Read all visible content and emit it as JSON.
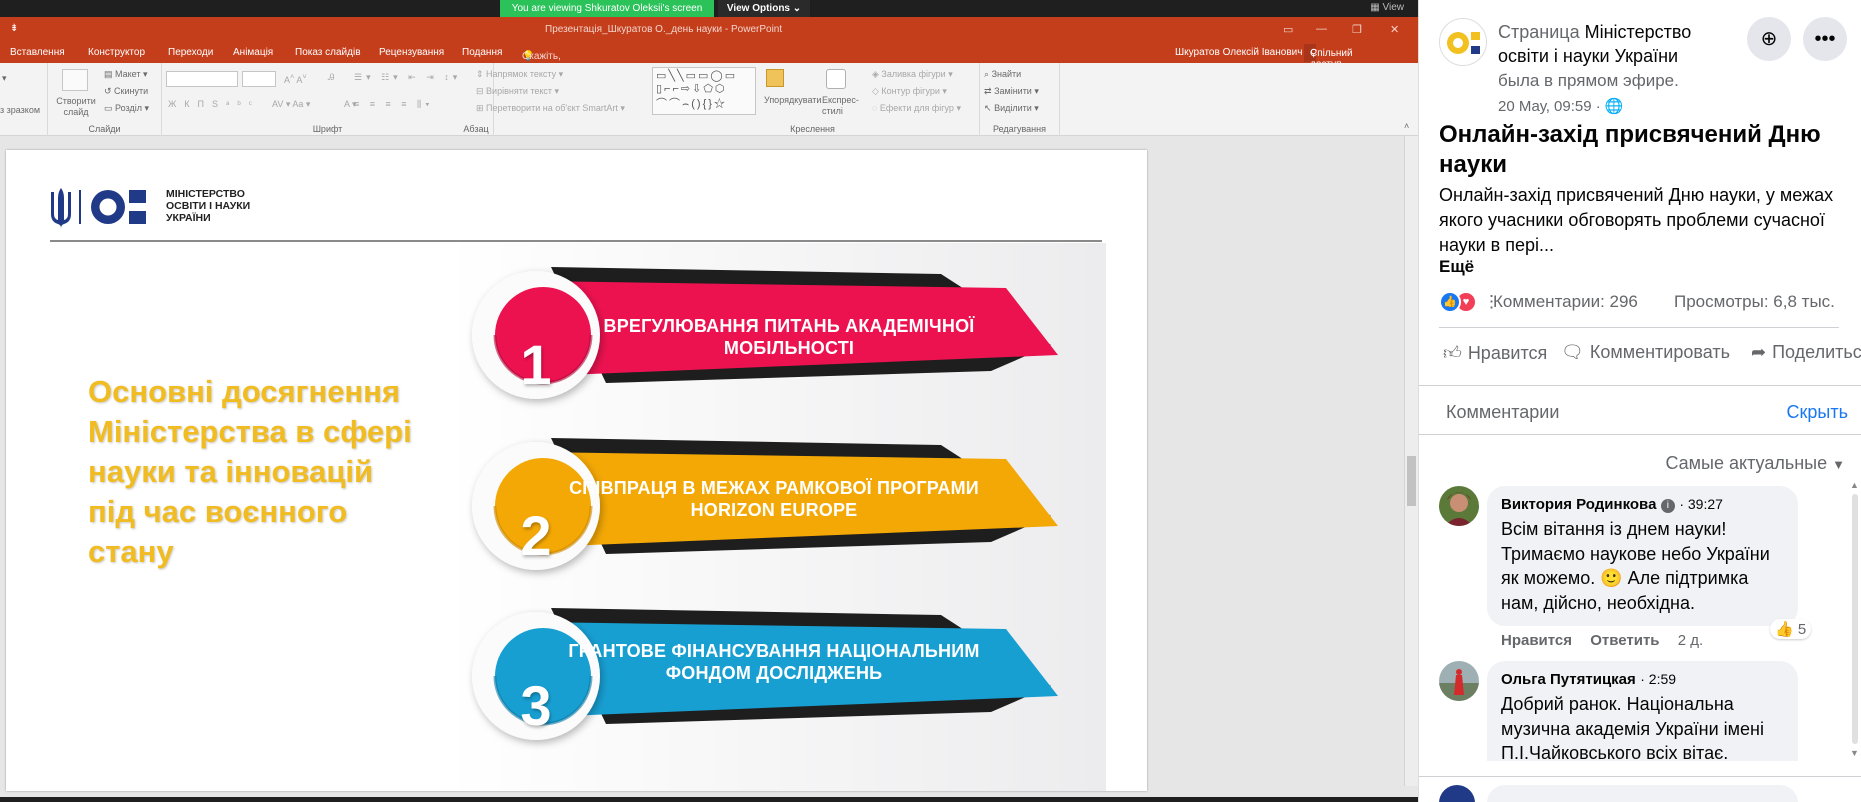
{
  "zoom": {
    "share_banner": "You are viewing Shkuratov Oleksii's screen",
    "view_options": "View Options",
    "view_label": "View"
  },
  "powerpoint": {
    "window_title": "Презентація_Шкуратов О._день науки - PowerPoint",
    "tabs": [
      "Вставлення",
      "Конструктор",
      "Переходи",
      "Анімація",
      "Показ слайдів",
      "Рецензування",
      "Подання"
    ],
    "tell_me": "Скажіть, що потрібно зробити...",
    "user": "Шкуратов Олексій Іванович",
    "share": "Спільний доступ",
    "ribbon": {
      "groups": [
        "Слайди",
        "Шрифт",
        "Абзац",
        "Креслення",
        "Редагування"
      ],
      "reuse": "з зразком",
      "new_slide": "Створити слайд",
      "layout": "Макет",
      "reset": "Скинути",
      "section": "Розділ",
      "text_direction": "Напрямок тексту",
      "align_text": "Вирівняти текст",
      "smartart": "Перетворити на об'єкт SmartArt",
      "arrange": "Упорядкувати",
      "quick_styles": "Експрес-стилі",
      "shape_fill": "Заливка фігури",
      "shape_outline": "Контур фігури",
      "shape_effects": "Ефекти для фігур",
      "find": "Знайти",
      "replace": "Замінити",
      "select": "Виділити"
    }
  },
  "slide": {
    "logo_text": [
      "МІНІСТЕРСТВО",
      "ОСВІТИ І НАУКИ",
      "УКРАЇНИ"
    ],
    "heading": "Основні досягнення Міністерства в сфері науки та інновацій під час воєнного стану",
    "items": [
      {
        "number": "1",
        "text": "ВРЕГУЛЮВАННЯ ПИТАНЬ АКАДЕМІЧНОЇ МОБІЛЬНОСТІ",
        "color": "#ec1250",
        "dark": "#b00a3a"
      },
      {
        "number": "2",
        "text": "СПІВПРАЦЯ В МЕЖАХ РАМКОВОЇ ПРОГРАМИ HORIZON EUROPE",
        "color": "#f4a805",
        "dark": "#c98700"
      },
      {
        "number": "3",
        "text": "ГРАНТОВЕ ФІНАНСУВАННЯ НАЦІОНАЛЬНИМ ФОНДОМ ДОСЛІДЖЕНЬ",
        "color": "#189fd2",
        "dark": "#0f7aa4"
      }
    ]
  },
  "facebook": {
    "page_prefix": "Страница",
    "page_name": "Міністерство освіти і науки України",
    "live_text": "была в прямом эфире.",
    "date": "20 Мау, 09:59 ·",
    "post_title": "Онлайн-захід присвячений Дню науки",
    "post_desc": "Онлайн-захід присвячений Дню науки, у межах якого учасники обговорять проблеми сучасної науки в пері...",
    "more": "Ещё",
    "comments_count": "Комментарии: 296",
    "views_count": "Просмотры: 6,8 тыс.",
    "actions": {
      "like": "Нравится",
      "comment": "Комментировать",
      "share": "Поделиться"
    },
    "comments_header": "Комментарии",
    "hide": "Скрыть",
    "sort": "Самые актуальные",
    "comments": [
      {
        "name": "Виктория Родинкова",
        "time": "· 39:27",
        "text": "Всім вітання із днем науки! Тримаємо наукове небо України як можемо. 🙂 Але підтримка нам, дійсно, необхідна.",
        "like": "Нравится",
        "reply": "Ответить",
        "age": "2 д.",
        "likes": "5"
      },
      {
        "name": "Ольга Путятицкая",
        "time": "· 2:59",
        "text": "Добрий ранок. Національна музична академія України імені П.І.Чайковського всіх вітає."
      }
    ],
    "colors": {
      "blue": "#1877f2",
      "grey": "#65676b",
      "bubble": "#f0f2f5"
    }
  }
}
